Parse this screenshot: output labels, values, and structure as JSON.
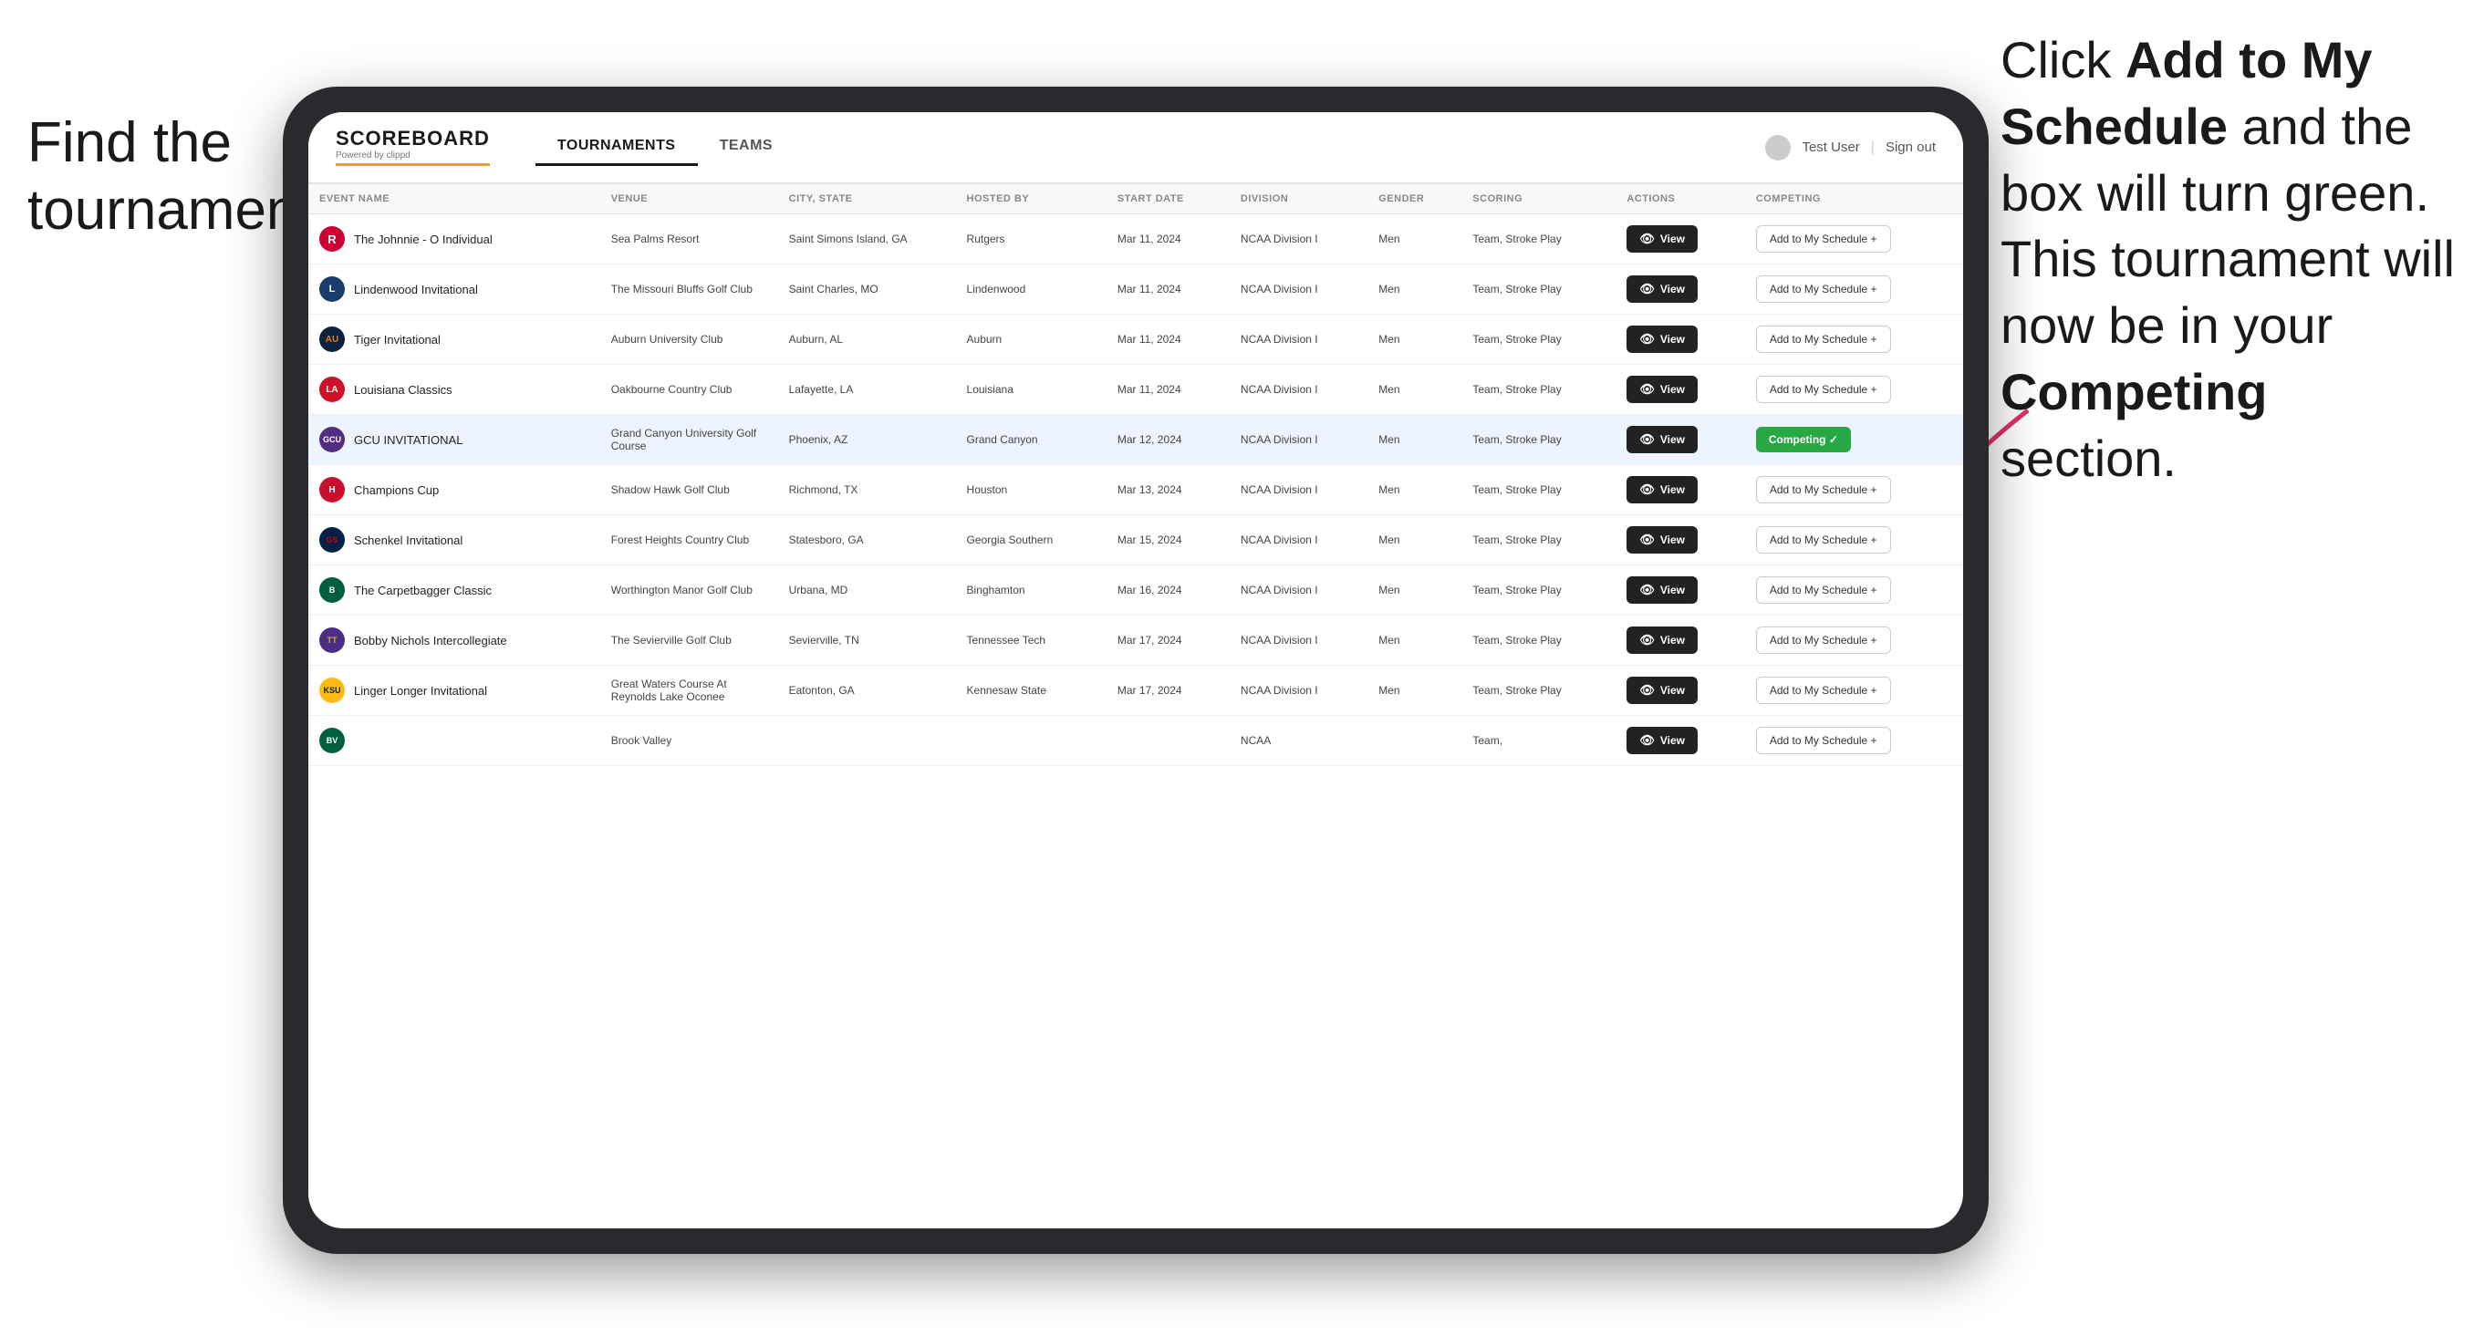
{
  "annotations": {
    "left_line1": "Find the",
    "left_line2": "tournament.",
    "right_text_plain": "Click ",
    "right_text_bold1": "Add to My Schedule",
    "right_text_mid": " and the box will turn green. This tournament will now be in your ",
    "right_text_bold2": "Competing",
    "right_text_end": " section."
  },
  "header": {
    "logo": "SCOREBOARD",
    "logo_sub": "Powered by clippd",
    "tabs": [
      {
        "label": "TOURNAMENTS",
        "active": true
      },
      {
        "label": "TEAMS",
        "active": false
      }
    ],
    "user": "Test User",
    "signout": "Sign out"
  },
  "table": {
    "columns": [
      "EVENT NAME",
      "VENUE",
      "CITY, STATE",
      "HOSTED BY",
      "START DATE",
      "DIVISION",
      "GENDER",
      "SCORING",
      "ACTIONS",
      "COMPETING"
    ],
    "rows": [
      {
        "logo_letter": "R",
        "logo_class": "logo-rutgers",
        "event_name": "The Johnnie - O Individual",
        "venue": "Sea Palms Resort",
        "city_state": "Saint Simons Island, GA",
        "hosted_by": "Rutgers",
        "start_date": "Mar 11, 2024",
        "division": "NCAA Division I",
        "gender": "Men",
        "scoring": "Team, Stroke Play",
        "view_label": "View",
        "competing_label": "Add to My Schedule +",
        "is_competing": false,
        "highlighted": false
      },
      {
        "logo_letter": "L",
        "logo_class": "logo-lindenwood",
        "event_name": "Lindenwood Invitational",
        "venue": "The Missouri Bluffs Golf Club",
        "city_state": "Saint Charles, MO",
        "hosted_by": "Lindenwood",
        "start_date": "Mar 11, 2024",
        "division": "NCAA Division I",
        "gender": "Men",
        "scoring": "Team, Stroke Play",
        "view_label": "View",
        "competing_label": "Add to My Schedule +",
        "is_competing": false,
        "highlighted": false
      },
      {
        "logo_letter": "AU",
        "logo_class": "logo-auburn",
        "event_name": "Tiger Invitational",
        "venue": "Auburn University Club",
        "city_state": "Auburn, AL",
        "hosted_by": "Auburn",
        "start_date": "Mar 11, 2024",
        "division": "NCAA Division I",
        "gender": "Men",
        "scoring": "Team, Stroke Play",
        "view_label": "View",
        "competing_label": "Add to My Schedule +",
        "is_competing": false,
        "highlighted": false
      },
      {
        "logo_letter": "LA",
        "logo_class": "logo-louisiana",
        "event_name": "Louisiana Classics",
        "venue": "Oakbourne Country Club",
        "city_state": "Lafayette, LA",
        "hosted_by": "Louisiana",
        "start_date": "Mar 11, 2024",
        "division": "NCAA Division I",
        "gender": "Men",
        "scoring": "Team, Stroke Play",
        "view_label": "View",
        "competing_label": "Add to My Schedule +",
        "is_competing": false,
        "highlighted": false
      },
      {
        "logo_letter": "GCU",
        "logo_class": "logo-gcu",
        "event_name": "GCU INVITATIONAL",
        "venue": "Grand Canyon University Golf Course",
        "city_state": "Phoenix, AZ",
        "hosted_by": "Grand Canyon",
        "start_date": "Mar 12, 2024",
        "division": "NCAA Division I",
        "gender": "Men",
        "scoring": "Team, Stroke Play",
        "view_label": "View",
        "competing_label": "Competing ✓",
        "is_competing": true,
        "highlighted": true
      },
      {
        "logo_letter": "H",
        "logo_class": "logo-houston",
        "event_name": "Champions Cup",
        "venue": "Shadow Hawk Golf Club",
        "city_state": "Richmond, TX",
        "hosted_by": "Houston",
        "start_date": "Mar 13, 2024",
        "division": "NCAA Division I",
        "gender": "Men",
        "scoring": "Team, Stroke Play",
        "view_label": "View",
        "competing_label": "Add to My Schedule +",
        "is_competing": false,
        "highlighted": false
      },
      {
        "logo_letter": "GS",
        "logo_class": "logo-georgia",
        "event_name": "Schenkel Invitational",
        "venue": "Forest Heights Country Club",
        "city_state": "Statesboro, GA",
        "hosted_by": "Georgia Southern",
        "start_date": "Mar 15, 2024",
        "division": "NCAA Division I",
        "gender": "Men",
        "scoring": "Team, Stroke Play",
        "view_label": "View",
        "competing_label": "Add to My Schedule +",
        "is_competing": false,
        "highlighted": false
      },
      {
        "logo_letter": "B",
        "logo_class": "logo-binghamton",
        "event_name": "The Carpetbagger Classic",
        "venue": "Worthington Manor Golf Club",
        "city_state": "Urbana, MD",
        "hosted_by": "Binghamton",
        "start_date": "Mar 16, 2024",
        "division": "NCAA Division I",
        "gender": "Men",
        "scoring": "Team, Stroke Play",
        "view_label": "View",
        "competing_label": "Add to My Schedule +",
        "is_competing": false,
        "highlighted": false
      },
      {
        "logo_letter": "TT",
        "logo_class": "logo-tenntech",
        "event_name": "Bobby Nichols Intercollegiate",
        "venue": "The Sevierville Golf Club",
        "city_state": "Sevierville, TN",
        "hosted_by": "Tennessee Tech",
        "start_date": "Mar 17, 2024",
        "division": "NCAA Division I",
        "gender": "Men",
        "scoring": "Team, Stroke Play",
        "view_label": "View",
        "competing_label": "Add to My Schedule +",
        "is_competing": false,
        "highlighted": false
      },
      {
        "logo_letter": "KSU",
        "logo_class": "logo-kennesaw",
        "event_name": "Linger Longer Invitational",
        "venue": "Great Waters Course At Reynolds Lake Oconee",
        "city_state": "Eatonton, GA",
        "hosted_by": "Kennesaw State",
        "start_date": "Mar 17, 2024",
        "division": "NCAA Division I",
        "gender": "Men",
        "scoring": "Team, Stroke Play",
        "view_label": "View",
        "competing_label": "Add to My Schedule +",
        "is_competing": false,
        "highlighted": false
      },
      {
        "logo_letter": "BV",
        "logo_class": "logo-binghamton",
        "event_name": "",
        "venue": "Brook Valley",
        "city_state": "",
        "hosted_by": "",
        "start_date": "",
        "division": "NCAA",
        "gender": "",
        "scoring": "Team,",
        "view_label": "View",
        "competing_label": "Add to My Schedule +",
        "is_competing": false,
        "highlighted": false
      }
    ]
  }
}
